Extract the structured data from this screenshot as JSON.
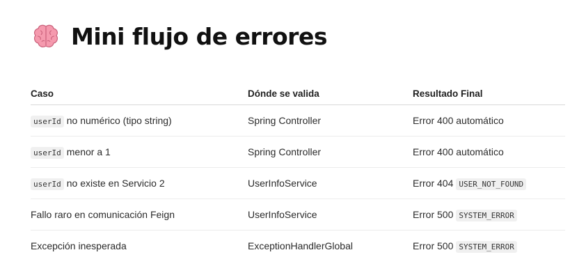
{
  "header": {
    "icon": "brain-icon",
    "title": "Mini flujo de errores"
  },
  "table": {
    "columns": [
      "Caso",
      "Dónde se valida",
      "Resultado Final"
    ],
    "rows": [
      {
        "caso_code": "userId",
        "caso_text": "no numérico (tipo string)",
        "donde": "Spring Controller",
        "resultado_text": "Error 400 automático",
        "resultado_code": ""
      },
      {
        "caso_code": "userId",
        "caso_text": "menor a 1",
        "donde": "Spring Controller",
        "resultado_text": "Error 400 automático",
        "resultado_code": ""
      },
      {
        "caso_code": "userId",
        "caso_text": "no existe en Servicio 2",
        "donde": "UserInfoService",
        "resultado_text": "Error 404",
        "resultado_code": "USER_NOT_FOUND"
      },
      {
        "caso_code": "",
        "caso_text": "Fallo raro en comunicación Feign",
        "donde": "UserInfoService",
        "resultado_text": "Error 500",
        "resultado_code": "SYSTEM_ERROR"
      },
      {
        "caso_code": "",
        "caso_text": "Excepción inesperada",
        "donde": "ExceptionHandlerGlobal",
        "resultado_text": "Error 500",
        "resultado_code": "SYSTEM_ERROR"
      }
    ]
  }
}
